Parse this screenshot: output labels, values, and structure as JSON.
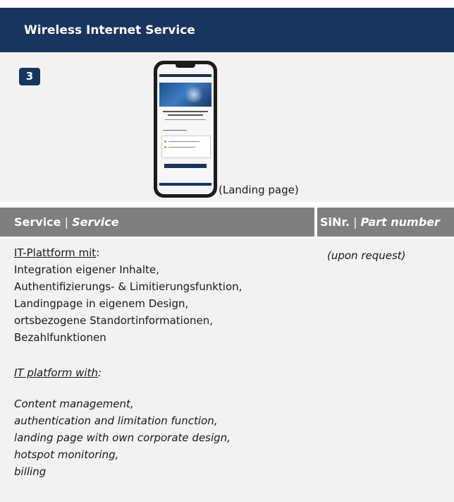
{
  "header": {
    "title": "Wireless Internet Service"
  },
  "image_panel": {
    "step_number": "3",
    "caption": "(Landing page)"
  },
  "table": {
    "col_service": {
      "de": "Service",
      "sep": " | ",
      "en": "Service"
    },
    "col_part": {
      "de": "SiNr.",
      "sep": " | ",
      "en": "Part number"
    }
  },
  "content": {
    "de_heading": "IT-Plattform mit",
    "de_colon": ":",
    "de_lines": [
      "Integration eigener Inhalte,",
      "Authentifizierungs- & Limitierungsfunktion,",
      "Landingpage in eigenem Design,",
      "ortsbezogene Standortinformationen,",
      "Bezahlfunktionen"
    ],
    "en_heading": "IT platform with",
    "en_colon": ":",
    "en_lines": [
      "Content management,",
      "authentication and limitation function,",
      "landing page with own corporate design,",
      "hotspot monitoring,",
      "billing"
    ],
    "part_number_note": "(upon request)"
  },
  "colors": {
    "header_bg": "#17355e",
    "table_header_bg": "#7f7f7f",
    "panel_bg": "#f2f2f2"
  }
}
